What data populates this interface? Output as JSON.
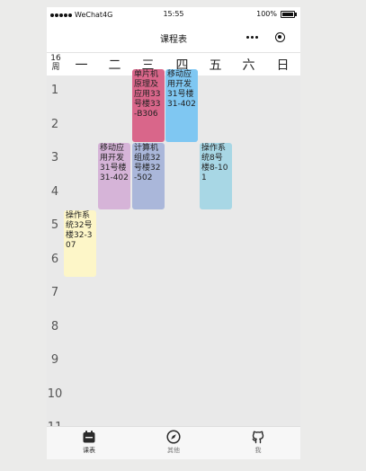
{
  "status_bar": {
    "carrier": "WeChat4G",
    "time": "15:55",
    "battery": "100%"
  },
  "nav": {
    "title": "课程表"
  },
  "week": {
    "number": "16",
    "unit": "周"
  },
  "days": [
    "一",
    "二",
    "三",
    "四",
    "五",
    "六",
    "日"
  ],
  "periods": [
    "1",
    "2",
    "3",
    "4",
    "5",
    "6",
    "7",
    "8",
    "9",
    "10",
    "11"
  ],
  "courses": [
    {
      "text": "单片机原理及应用33号楼33-B306",
      "day": 3,
      "start": 1,
      "span": 2,
      "color": "#d9668a"
    },
    {
      "text": "移动应用开发31号楼31-402",
      "day": 4,
      "start": 1,
      "span": 2,
      "color": "#7fc7f2"
    },
    {
      "text": "移动应用开发31号楼31-402",
      "day": 2,
      "start": 3,
      "span": 2,
      "color": "#d6b4d8"
    },
    {
      "text": "计算机组成32号楼32-502",
      "day": 3,
      "start": 3,
      "span": 2,
      "color": "#aab7da"
    },
    {
      "text": "操作系统8号楼8-101",
      "day": 5,
      "start": 3,
      "span": 2,
      "color": "#a8d7e5"
    },
    {
      "text": "操作系统32号楼32-307",
      "day": 1,
      "start": 5,
      "span": 2,
      "color": "#fdf6c8"
    }
  ],
  "tabs": [
    {
      "label": "课表",
      "icon": "calendar-icon",
      "active": true
    },
    {
      "label": "其他",
      "icon": "compass-icon",
      "active": false
    },
    {
      "label": "我",
      "icon": "github-icon",
      "active": false
    }
  ]
}
